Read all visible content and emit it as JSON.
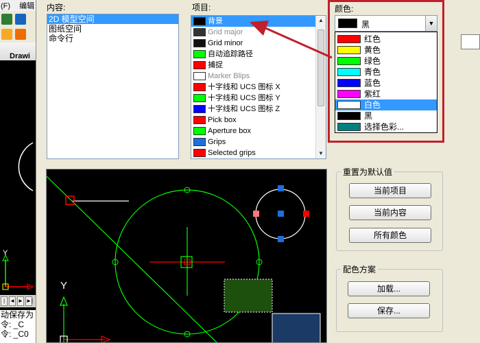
{
  "background_app": {
    "menu": [
      "(F)",
      "编辑"
    ],
    "tab_label": "Drawi",
    "command_lines": [
      "动保存为",
      "令:  _C",
      "令:  _C0"
    ],
    "nav_buttons": [
      "|◄",
      "◄",
      "►",
      "►|"
    ]
  },
  "dialog": {
    "context_label": "内容:",
    "context_items": [
      {
        "label": "2D 模型空间",
        "selected": true
      },
      {
        "label": "图纸空间",
        "selected": false
      },
      {
        "label": "命令行",
        "selected": false
      }
    ],
    "items_label": "项目:",
    "items": [
      {
        "label": "背景",
        "color": "#000000",
        "selected": true,
        "dim": false
      },
      {
        "label": "Grid major",
        "color": "#333333",
        "selected": false,
        "dim": true
      },
      {
        "label": "Grid minor",
        "color": "#111111",
        "selected": false,
        "dim": false
      },
      {
        "label": "自动追踪路径",
        "color": "#00ff00",
        "selected": false,
        "dim": false
      },
      {
        "label": "捕捉",
        "color": "#ff0000",
        "selected": false,
        "dim": false
      },
      {
        "label": "Marker Blips",
        "color": "#ffffff",
        "selected": false,
        "dim": true
      },
      {
        "label": "十字线和 UCS 图标 X",
        "color": "#ff0000",
        "selected": false,
        "dim": false
      },
      {
        "label": "十字线和 UCS 图标 Y",
        "color": "#00ff00",
        "selected": false,
        "dim": false
      },
      {
        "label": "十字线和 UCS 图标 Z",
        "color": "#0000ff",
        "selected": false,
        "dim": false
      },
      {
        "label": "Pick box",
        "color": "#ff0000",
        "selected": false,
        "dim": false
      },
      {
        "label": "Aperture box",
        "color": "#00ff00",
        "selected": false,
        "dim": false
      },
      {
        "label": "Grips",
        "color": "#1e6fd9",
        "selected": false,
        "dim": false
      },
      {
        "label": "Selected grips",
        "color": "#ff0000",
        "selected": false,
        "dim": false
      }
    ],
    "color_label": "颜色:",
    "color_current": {
      "label": "黑",
      "color": "#000000"
    },
    "color_options": [
      {
        "label": "红色",
        "color": "#ff0000",
        "selected": false
      },
      {
        "label": "黄色",
        "color": "#ffff00",
        "selected": false
      },
      {
        "label": "绿色",
        "color": "#00ff00",
        "selected": false
      },
      {
        "label": "青色",
        "color": "#00ffff",
        "selected": false
      },
      {
        "label": "蓝色",
        "color": "#0000ff",
        "selected": false
      },
      {
        "label": "紫红",
        "color": "#ff00ff",
        "selected": false
      },
      {
        "label": "白色",
        "color": "#ffffff",
        "selected": true
      },
      {
        "label": "黑",
        "color": "#000000",
        "selected": false
      },
      {
        "label": "选择色彩...",
        "color": "#008080",
        "selected": false
      }
    ],
    "reset_group": {
      "title": "重置为默认值",
      "buttons": [
        "当前项目",
        "当前内容",
        "所有颜色"
      ]
    },
    "scheme_group": {
      "title": "配色方案",
      "buttons": [
        "加载...",
        "保存..."
      ]
    },
    "preview": {
      "axis_label_y": "Y"
    }
  },
  "annotation": {
    "highlight_color": "#c0202a"
  }
}
